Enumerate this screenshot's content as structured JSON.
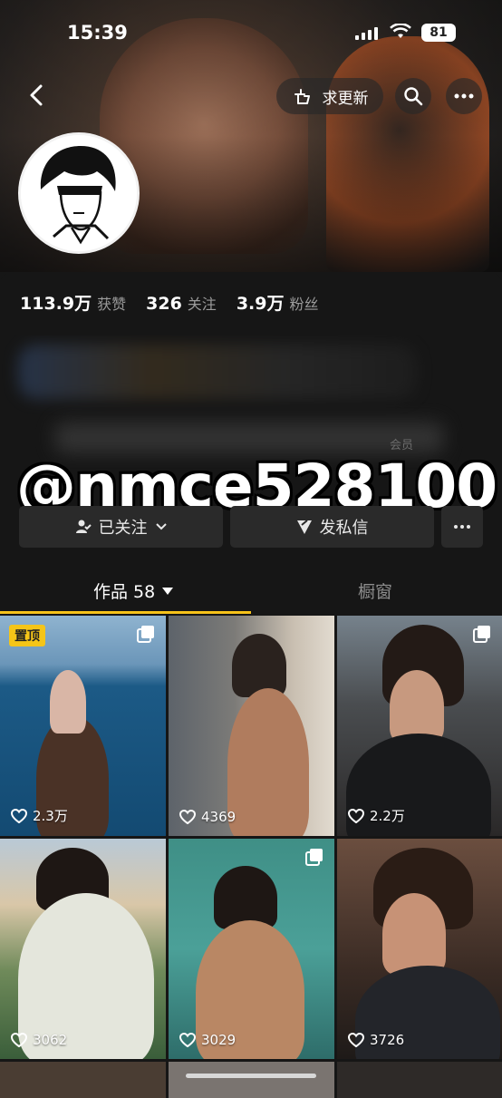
{
  "status_bar": {
    "time": "15:39",
    "battery": "81"
  },
  "header": {
    "update_label": "求更新"
  },
  "stats": [
    {
      "num": "113.9万",
      "label": "获赞"
    },
    {
      "num": "326",
      "label": "关注"
    },
    {
      "num": "3.9万",
      "label": "粉丝"
    }
  ],
  "bio": {
    "member_tag": "会员"
  },
  "watermark": "@nmce528100",
  "actions": {
    "follow": "已关注",
    "message": "发私信"
  },
  "tabs": {
    "works": "作品 58",
    "showcase": "橱窗"
  },
  "posts": [
    {
      "likes": "2.3万",
      "pinned": "置顶",
      "multi": true
    },
    {
      "likes": "4369"
    },
    {
      "likes": "2.2万",
      "multi": true
    },
    {
      "likes": "3062"
    },
    {
      "likes": "3029",
      "multi": true
    },
    {
      "likes": "3726"
    }
  ],
  "colors": {
    "accent": "#f6c21a",
    "background": "#161616",
    "button": "#2a2a2a"
  }
}
